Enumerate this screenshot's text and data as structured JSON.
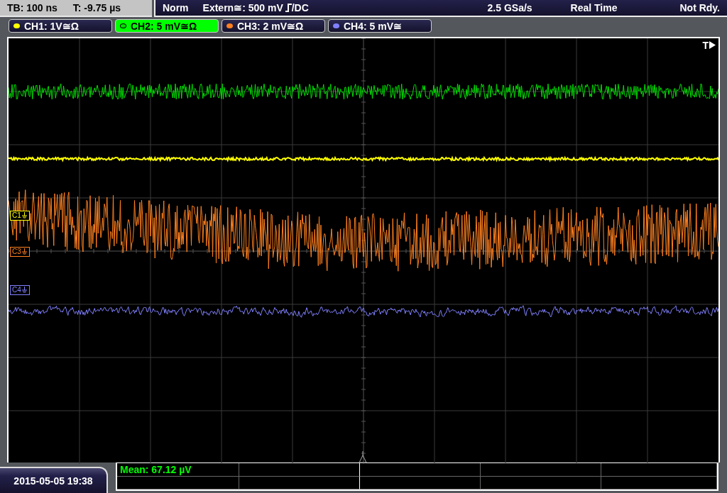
{
  "header": {
    "timebase": "TB: 100 ns",
    "trigger_time": "T: -9.75 µs",
    "mode": "Norm",
    "trigger_source": "Extern≅: 500 mV",
    "trigger_coupling": "/DC",
    "sample_rate": "2.5 GSa/s",
    "acquisition": "Real Time",
    "status": "Not Rdy."
  },
  "channels": [
    {
      "label": "CH1: 1V≅Ω",
      "color": "#ffff00",
      "selected": false
    },
    {
      "label": "CH2: 5 mV≅Ω",
      "color": "#00e000",
      "selected": true
    },
    {
      "label": "CH3: 2 mV≅Ω",
      "color": "#ff8020",
      "selected": false
    },
    {
      "label": "CH4: 5 mV≅",
      "color": "#8080ff",
      "selected": false
    }
  ],
  "markers": [
    {
      "label": "C1",
      "color": "#ffff00"
    },
    {
      "label": "C3",
      "color": "#ff8020"
    },
    {
      "label": "C4",
      "color": "#8080ff"
    }
  ],
  "trigger_marker": "T",
  "date_time": "2015-05-05 19:38",
  "measurement": "Mean: 67.12 µV"
}
